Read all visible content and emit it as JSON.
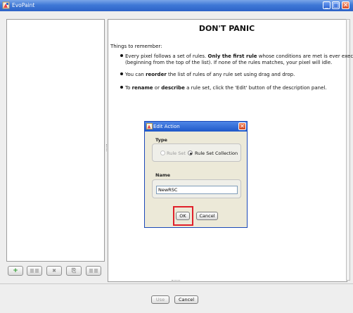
{
  "window": {
    "title": "EvoPaint",
    "minimize_glyph": "_",
    "maximize_glyph": "□",
    "close_glyph": "✕"
  },
  "toolbar": {
    "add_glyph": "+",
    "remove_glyph": "✖",
    "copy_glyph": "⎘"
  },
  "panel": {
    "heading": "DON'T PANIC",
    "intro": "Things to remember:",
    "bullet1": {
      "pre": "Every pixel follows a set of rules. ",
      "bold": "Only the first rule",
      "post": " whose conditions are met is ever executed",
      "line2": "(beginning from the top of the list). If none of the rules matches, your pixel will idle."
    },
    "bullet2": {
      "pre": "You can ",
      "bold": "reorder",
      "post": " the list of rules of any rule set using drag and drop."
    },
    "bullet3": {
      "pre": "To ",
      "bold1": "rename",
      "mid": " or ",
      "bold2": "describe",
      "post": " a rule set, click the 'Edit' button of the description panel."
    }
  },
  "footer": {
    "use_label": "Use",
    "cancel_label": "Cancel"
  },
  "dialog": {
    "title": "Edit Action",
    "close_glyph": "✕",
    "type_label": "Type",
    "option_rule_set": "Rule Set",
    "option_rule_set_collection": "Rule Set Collection",
    "selected_option": "Rule Set Collection",
    "name_label": "Name",
    "name_value": "NewRSC",
    "ok_label": "OK",
    "cancel_label": "Cancel"
  },
  "colors": {
    "title_blue": "#2d63c8",
    "highlight_red": "#e0202a",
    "add_green": "#2e9b2e"
  }
}
